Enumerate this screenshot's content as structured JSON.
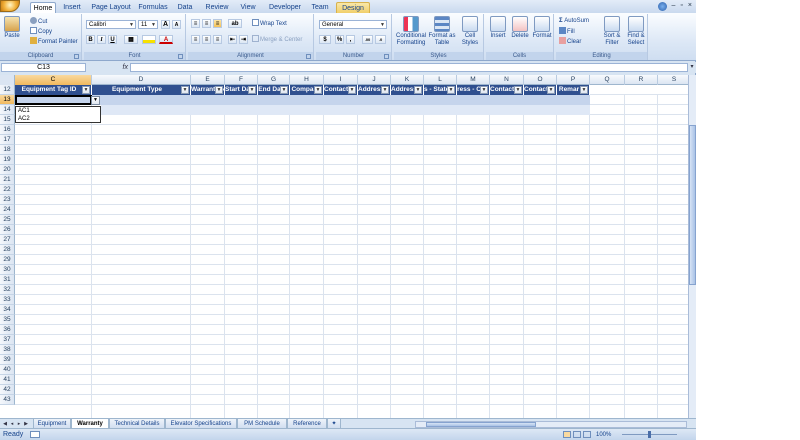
{
  "ribbon_tabs": [
    "Home",
    "Insert",
    "Page Layout",
    "Formulas",
    "Data",
    "Review",
    "View",
    "Developer",
    "Team"
  ],
  "contextual_tab": "Design",
  "window_controls": [
    "–",
    "▫",
    "×"
  ],
  "clipboard": {
    "paste": "Paste",
    "cut": "Cut",
    "copy": "Copy",
    "format_painter": "Format Painter",
    "label": "Clipboard"
  },
  "font": {
    "name": "Calibri",
    "size": "11",
    "grow": "A",
    "shrink": "A",
    "bold": "B",
    "italic": "I",
    "underline": "U",
    "label": "Font"
  },
  "alignment": {
    "wrap": "Wrap Text",
    "merge": "Merge & Center",
    "label": "Alignment"
  },
  "number": {
    "format": "General",
    "currency": "$",
    "percent": "%",
    "comma": ",",
    "inc": ".00",
    "label": "Number"
  },
  "styles": {
    "conditional": "Conditional Formatting",
    "format_table": "Format as Table",
    "cell_styles": "Cell Styles",
    "label": "Styles"
  },
  "cells": {
    "insert": "Insert",
    "delete": "Delete",
    "format": "Format",
    "label": "Cells"
  },
  "editing": {
    "autosum": "AutoSum",
    "fill": "Fill",
    "clear": "Clear",
    "sort": "Sort & Filter",
    "find": "Find & Select",
    "label": "Editing"
  },
  "formula_bar": {
    "name_box": "C13",
    "fx": "fx",
    "value": ""
  },
  "columns": [
    "C",
    "D",
    "E",
    "F",
    "G",
    "H",
    "I",
    "J",
    "K",
    "L",
    "M",
    "N",
    "O",
    "P",
    "Q",
    "R",
    "S"
  ],
  "selected_column": "C",
  "rows": [
    "12",
    "13",
    "14",
    "15",
    "16",
    "17",
    "18",
    "19",
    "20",
    "21",
    "22",
    "23",
    "24",
    "25",
    "26",
    "27",
    "28",
    "29",
    "30",
    "31",
    "32",
    "33",
    "34",
    "35",
    "36",
    "37",
    "38",
    "39",
    "40",
    "41",
    "42",
    "43"
  ],
  "selected_row": "13",
  "headers": [
    "Equipment Tag ID",
    "Equipment Type",
    "Warranty N",
    "Start Da",
    "End Da",
    "Compa",
    "Contact N",
    "Address - ",
    "Address - ",
    "s - State",
    "ress - C",
    "Contact P",
    "Contact E",
    "Remar"
  ],
  "dropdown_options": [
    "AC1",
    "AC2"
  ],
  "sheet_tabs": [
    "Equipment",
    "Warranty",
    "Technical Details",
    "Elevator Specifications",
    "PM Schedule",
    "Reference"
  ],
  "active_sheet": "Warranty",
  "status": {
    "ready": "Ready",
    "zoom": "100%"
  }
}
